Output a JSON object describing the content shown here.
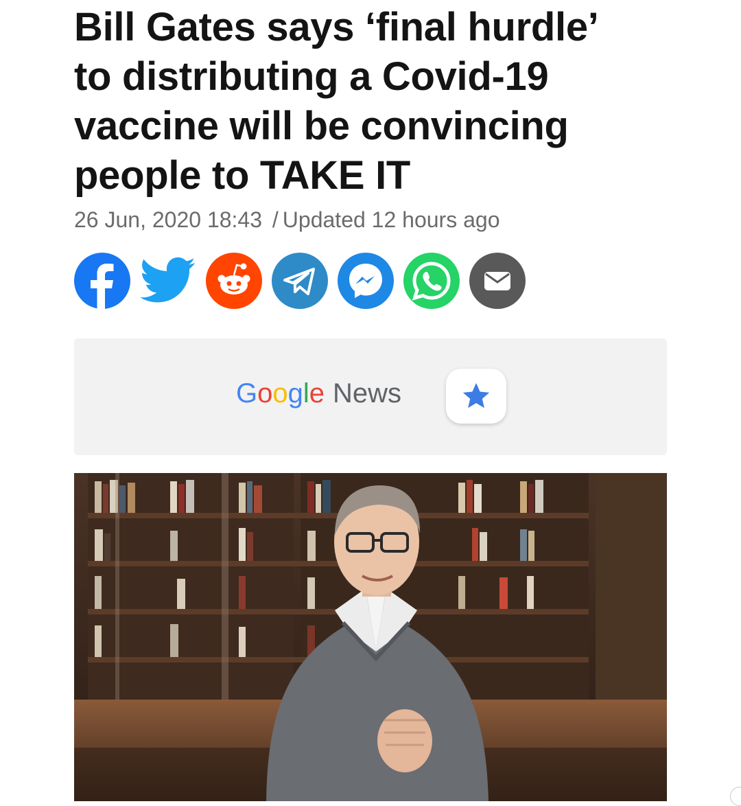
{
  "article": {
    "headline_lines": [
      "Bill Gates says ‘final hurdle’",
      "to distributing a Covid-19",
      "vaccine will be convincing",
      "people to TAKE IT"
    ],
    "date": "26 Jun, 2020 18:43",
    "separator": "/",
    "updated": "Updated 12 hours ago"
  },
  "share": {
    "buttons": [
      {
        "name": "facebook",
        "icon": "facebook-icon",
        "color": "#1877F2"
      },
      {
        "name": "twitter",
        "icon": "twitter-icon",
        "color": "#1DA1F2"
      },
      {
        "name": "reddit",
        "icon": "reddit-icon",
        "color": "#FF4500"
      },
      {
        "name": "telegram",
        "icon": "telegram-icon",
        "color": "#2E8BC8"
      },
      {
        "name": "messenger",
        "icon": "messenger-icon",
        "color": "#1E88E5"
      },
      {
        "name": "whatsapp",
        "icon": "whatsapp-icon",
        "color": "#25D366"
      },
      {
        "name": "email",
        "icon": "email-icon",
        "color": "#595959"
      }
    ]
  },
  "google_news": {
    "logo_letters": [
      "G",
      "o",
      "o",
      "g",
      "l",
      "e"
    ],
    "news_label": "News",
    "star_icon": "star-icon",
    "star_color": "#3D7DE3"
  },
  "image": {
    "description_icon": "article-photo",
    "colors": {
      "shelf": "#5a3a26",
      "sweater": "#6a6d72",
      "background": "#3a2a20"
    }
  }
}
